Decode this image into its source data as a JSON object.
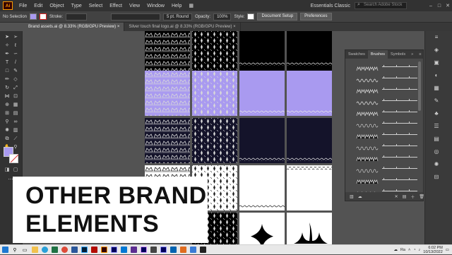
{
  "menubar": {
    "app_icon": "Ai",
    "items": [
      "File",
      "Edit",
      "Object",
      "Type",
      "Select",
      "Effect",
      "View",
      "Window",
      "Help"
    ],
    "workspace": "Essentials Classic",
    "search_placeholder": "Search Adobe Stock"
  },
  "controlbar": {
    "selection": "No Selection",
    "stroke_label": "Stroke:",
    "brush_value": "5 pt. Round",
    "opacity_label": "Opacity:",
    "opacity_value": "100%",
    "style_label": "Style:",
    "document_setup": "Document Setup",
    "preferences": "Preferences"
  },
  "tabs": [
    {
      "label": "Brand assets.ai @ 8.33% (RGB/GPU Preview)",
      "close": "×"
    },
    {
      "label": "Silver touch final logo.ai @ 8.33% (RGB/GPU Preview)",
      "close": "×"
    }
  ],
  "panel": {
    "tabs": [
      "Swatches",
      "Brushes",
      "Symbols"
    ],
    "active_tab": "Brushes"
  },
  "overlay": {
    "line1": "OTHER BRAND",
    "line2": "ELEMENTS"
  },
  "taskbar": {
    "time": "6:02 PM",
    "date": "10/13/2022",
    "tray_text": "Ra"
  },
  "colors": {
    "lavender": "#a99af0",
    "dark_navy": "#14132a",
    "black": "#000000",
    "white": "#ffffff",
    "overlay_bg": "#ffffff"
  }
}
